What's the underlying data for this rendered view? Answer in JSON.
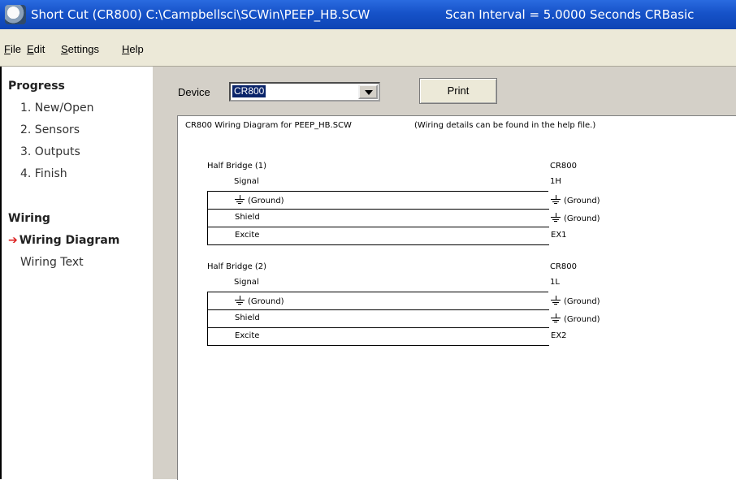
{
  "titlebar": {
    "title": "Short Cut (CR800) C:\\Campbellsci\\SCWin\\PEEP_HB.SCW",
    "scan_info": "Scan Interval = 5.0000 Seconds CRBasic"
  },
  "menu": {
    "items": [
      "File",
      "Edit",
      "Settings",
      "Help"
    ]
  },
  "left_panel": {
    "progress_header": "Progress",
    "progress_items": [
      "1. New/Open",
      "2. Sensors",
      "3. Outputs",
      "4. Finish"
    ],
    "wiring_header": "Wiring",
    "wiring_items": [
      "Wiring Diagram",
      "Wiring Text"
    ],
    "active_item": "Wiring Diagram",
    "arrow": "➔",
    "accent_color": "#dd2222"
  },
  "toolbar": {
    "device_label": "Device",
    "device_value": "CR800",
    "print_label": "Print"
  },
  "diagram": {
    "title": "CR800 Wiring Diagram for PEEP_HB.SCW",
    "note": "(Wiring details can be found in the help file.)",
    "blocks": [
      {
        "header": "Half Bridge (1)",
        "device": "CR800",
        "rows": [
          {
            "label": "Signal",
            "value": "1H"
          },
          {
            "label": "(Ground)",
            "value": "(Ground)"
          },
          {
            "label": "Shield",
            "value": "(Ground)"
          },
          {
            "label": "Excite",
            "value": "EX1"
          }
        ]
      },
      {
        "header": "Half Bridge (2)",
        "device": "CR800",
        "rows": [
          {
            "label": "Signal",
            "value": "1L"
          },
          {
            "label": "(Ground)",
            "value": "(Ground)"
          },
          {
            "label": "Shield",
            "value": "(Ground)"
          },
          {
            "label": "Excite",
            "value": "EX2"
          }
        ]
      }
    ]
  }
}
